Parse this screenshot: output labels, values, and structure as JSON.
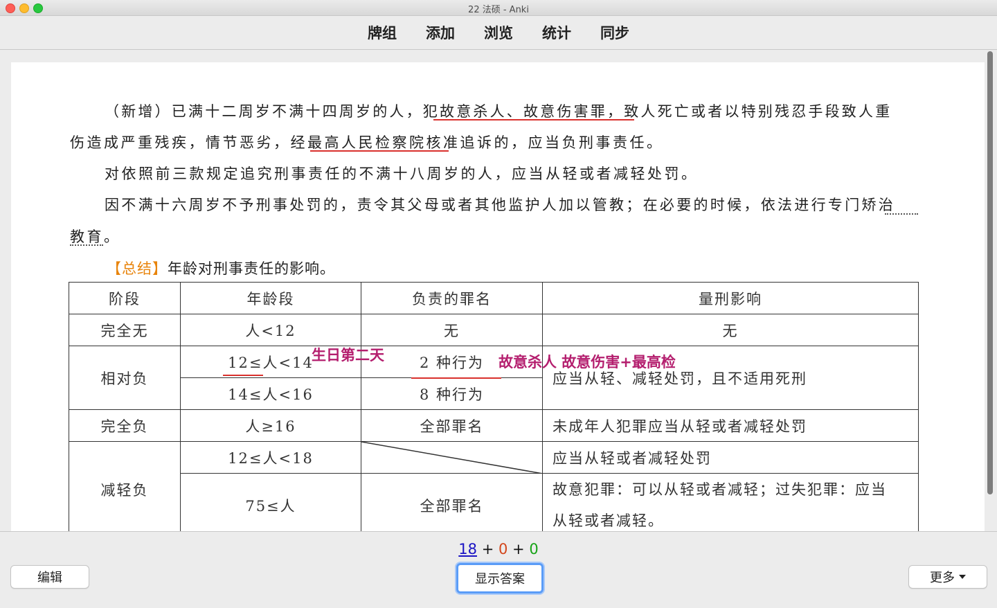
{
  "window": {
    "title": "22 法硕 - Anki"
  },
  "toolbar": {
    "items": [
      "牌组",
      "添加",
      "浏览",
      "统计",
      "同步"
    ]
  },
  "card": {
    "para1_line1": "（新增）已满十二周岁不满十四周岁的人，犯故意杀人、故意伤害罪，致人死亡或者以特别残忍手段致人重",
    "para1_line2": "伤造成严重残疾，情节恶劣，经最高人民检察院核准追诉的，应当负刑事责任。",
    "para2": "对依照前三款规定追究刑事责任的不满十八周岁的人，应当从轻或者减轻处罚。",
    "para3_line1": "因不满十六周岁不予刑事处罚的，责令其父母或者其他监护人加以管教；在必要的时候，依法进行专门矫治",
    "para3_line2": "教育。",
    "summary_open": "【",
    "summary_label": "总结",
    "summary_close": "】",
    "summary_text": "年龄对刑事责任的影响。",
    "table": {
      "headers": [
        "阶段",
        "年龄段",
        "负责的罪名",
        "量刑影响"
      ],
      "r1": [
        "完全无",
        "人<12",
        "无",
        "无"
      ],
      "r2": {
        "stage": "相对负",
        "age_a": "12≤人<14",
        "crime_a": "2 种行为",
        "age_b": "14≤人<16",
        "crime_b": "8 种行为",
        "effect": "应当从轻、减轻处罚，且不适用死刑"
      },
      "r3": [
        "完全负",
        "人≥16",
        "全部罪名",
        "未成年人犯罪应当从轻或者减轻处罚"
      ],
      "r4": {
        "stage": "减轻负",
        "age_a": "12≤人<18",
        "effect_a": "应当从轻或者减轻处罚",
        "age_b": "75≤人",
        "crime_b": "全部罪名",
        "effect_b_line1": "故意犯罪：可以从轻或者减轻；过失犯罪：应当",
        "effect_b_line2": "从轻或者减轻。"
      }
    },
    "annotations": {
      "birthday": "生日第二天",
      "crimes": "故意杀人 故意伤害+最高检"
    }
  },
  "counts": {
    "new": "18",
    "plus1": "+",
    "learning": "0",
    "plus2": "+",
    "review": "0"
  },
  "buttons": {
    "edit": "编辑",
    "show_answer": "显示答案",
    "more": "更多"
  }
}
